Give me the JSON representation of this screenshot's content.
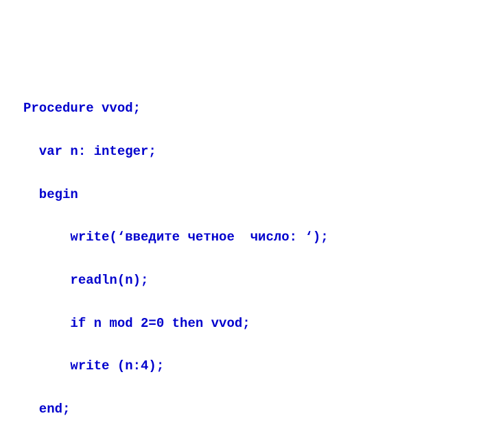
{
  "code": {
    "lines": [
      "Procedure vvod;",
      "  var n: integer;",
      "  begin",
      "      write(‘введите четное  число: ‘);",
      "      readln(n);",
      "      if n mod 2=0 then vvod;",
      "      write (n:4);",
      "  end;"
    ]
  }
}
